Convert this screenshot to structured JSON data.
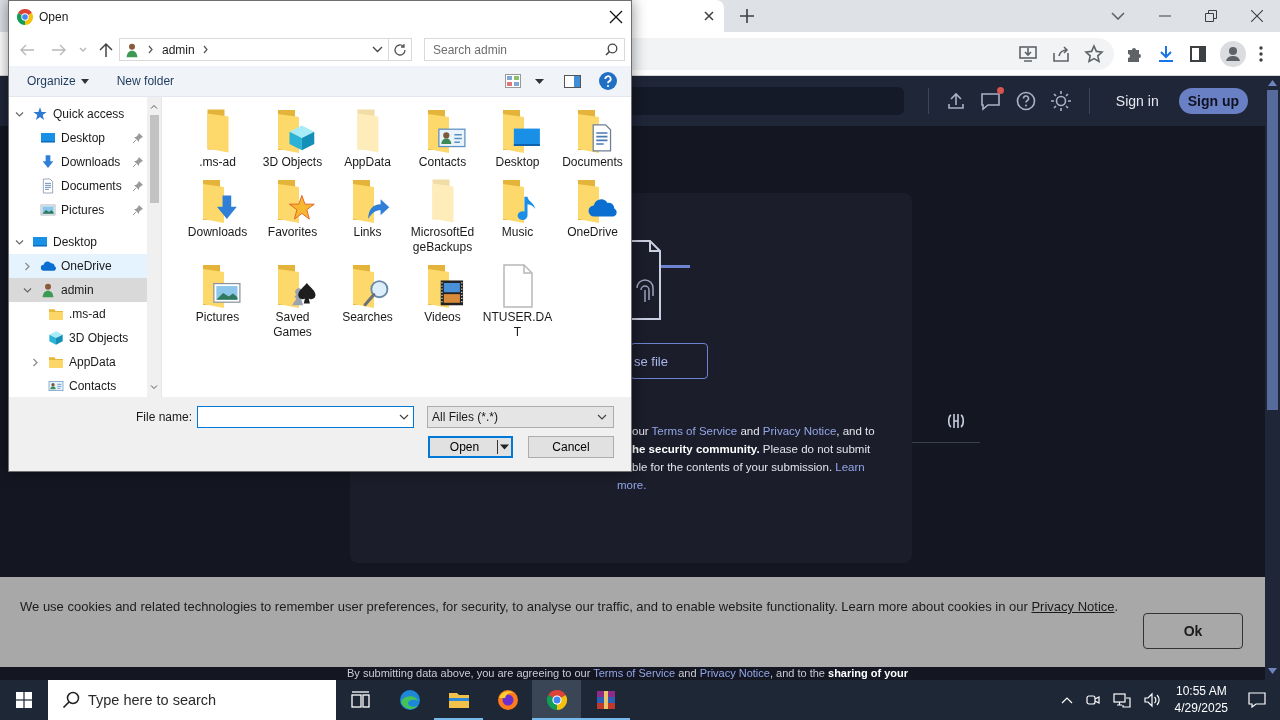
{
  "site_header": {
    "notification_unread": true,
    "sign_in": "Sign in",
    "sign_up": "Sign up"
  },
  "upload_card": {
    "choose_button": "se file",
    "terms": [
      [
        {
          "kind": "text",
          "text": "our "
        },
        {
          "kind": "link",
          "text": "Terms of Service"
        },
        {
          "kind": "text",
          "text": " and "
        },
        {
          "kind": "link",
          "text": "Privacy Notice"
        },
        {
          "kind": "text",
          "text": ", and to"
        }
      ],
      [
        {
          "kind": "bold",
          "text": "he security community."
        },
        {
          "kind": "text",
          "text": " Please do not submit"
        }
      ],
      [
        {
          "kind": "text",
          "text": "ble for the contents of your submission. "
        },
        {
          "kind": "link",
          "text": "Learn"
        }
      ],
      [
        {
          "kind": "link",
          "text": "more."
        }
      ]
    ]
  },
  "footer_note": [
    {
      "kind": "text",
      "text": "By submitting data above, you are agreeing to our "
    },
    {
      "kind": "link",
      "text": "Terms of Service"
    },
    {
      "kind": "text",
      "text": " and "
    },
    {
      "kind": "link",
      "text": "Privacy Notice"
    },
    {
      "kind": "text",
      "text": ", and to the "
    },
    {
      "kind": "bold",
      "text": "sharing of your"
    }
  ],
  "cookie_banner": {
    "text": "We use cookies and related technologies to remember user preferences, for security, to analyse our traffic, and to enable website functionality. Learn more about cookies in our ",
    "link": "Privacy Notice",
    "text_after": ".",
    "button": "Ok"
  },
  "dialog": {
    "title": "Open",
    "address": {
      "path": [
        "admin"
      ]
    },
    "search": {
      "placeholder": "Search admin"
    },
    "commands": {
      "organize": "Organize",
      "new_folder": "New folder"
    },
    "navigation": [
      {
        "label": "Quick access",
        "kind": "star",
        "expanded": true,
        "selected": false,
        "hovered": false,
        "children": [
          {
            "label": "Desktop",
            "kind": "desktop",
            "pinned": true,
            "selected": false,
            "hovered": false
          },
          {
            "label": "Downloads",
            "kind": "downloads",
            "pinned": true,
            "selected": false,
            "hovered": false
          },
          {
            "label": "Documents",
            "kind": "documents",
            "pinned": true,
            "selected": false,
            "hovered": false
          },
          {
            "label": "Pictures",
            "kind": "pictures",
            "pinned": true,
            "selected": false,
            "hovered": false
          }
        ]
      },
      {
        "label": "Desktop",
        "kind": "desktop",
        "expanded": true,
        "selected": false,
        "hovered": false,
        "children": [
          {
            "label": "OneDrive",
            "kind": "onedrive",
            "expanded": false,
            "selected": false,
            "hovered": true
          },
          {
            "label": "admin",
            "kind": "user",
            "expanded": true,
            "selected": true,
            "hovered": false,
            "children": [
              {
                "label": ".ms-ad",
                "kind": "folder",
                "selected": false,
                "hovered": false
              },
              {
                "label": "3D Objects",
                "kind": "cube",
                "selected": false,
                "hovered": false
              },
              {
                "label": "AppData",
                "kind": "folder",
                "expanded": false,
                "selected": false,
                "hovered": false
              },
              {
                "label": "Contacts",
                "kind": "contacts",
                "selected": false,
                "hovered": false
              }
            ]
          }
        ]
      }
    ],
    "items": [
      {
        "label": ".ms-ad",
        "kind": "folder"
      },
      {
        "label": "3D Objects",
        "kind": "cube"
      },
      {
        "label": "AppData",
        "kind": "hidden-folder"
      },
      {
        "label": "Contacts",
        "kind": "contacts"
      },
      {
        "label": "Desktop",
        "kind": "desktop"
      },
      {
        "label": "Documents",
        "kind": "documents"
      },
      {
        "label": "Downloads",
        "kind": "downloads"
      },
      {
        "label": "Favorites",
        "kind": "favorites"
      },
      {
        "label": "Links",
        "kind": "links"
      },
      {
        "label": "MicrosoftEdgeBackups",
        "kind": "hidden-folder"
      },
      {
        "label": "Music",
        "kind": "music"
      },
      {
        "label": "OneDrive",
        "kind": "onedrive"
      },
      {
        "label": "Pictures",
        "kind": "pictures"
      },
      {
        "label": "Saved Games",
        "kind": "games"
      },
      {
        "label": "Searches",
        "kind": "searches"
      },
      {
        "label": "Videos",
        "kind": "videos"
      },
      {
        "label": "NTUSER.DAT",
        "kind": "file"
      }
    ],
    "file_name": {
      "label": "File name:"
    },
    "file_type": "All Files (*.*)",
    "buttons": {
      "open": "Open",
      "cancel": "Cancel"
    }
  },
  "taskbar": {
    "search": {
      "placeholder": "Type here to search"
    },
    "apps": [
      {
        "kind": "edge",
        "running": false,
        "active": false
      },
      {
        "kind": "explorer",
        "running": true,
        "active": false
      },
      {
        "kind": "firefox",
        "running": false,
        "active": false
      },
      {
        "kind": "chrome",
        "running": true,
        "active": true
      },
      {
        "kind": "winrar",
        "running": true,
        "active": false
      }
    ],
    "time": "10:55 AM",
    "date": "4/29/2025"
  }
}
